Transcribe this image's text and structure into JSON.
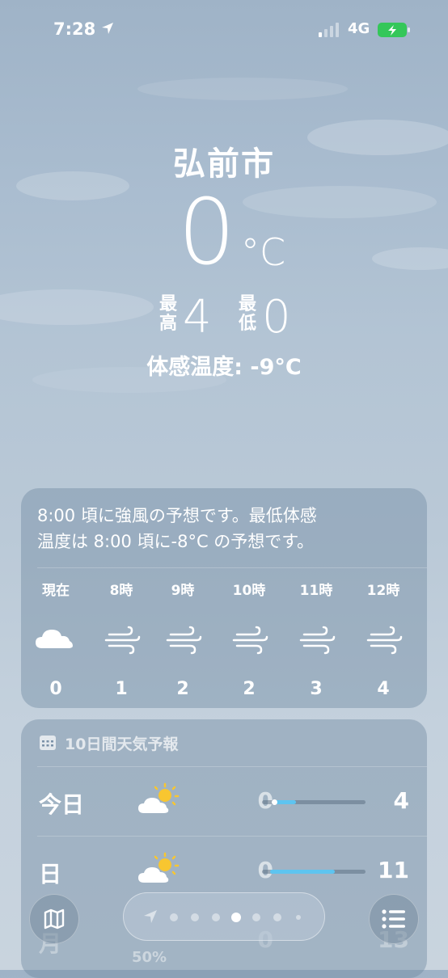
{
  "status_bar": {
    "time": "7:28",
    "network": "4G"
  },
  "header": {
    "city": "弘前市",
    "temperature": "0",
    "unit": "°C",
    "high_label": "最高",
    "high_value": "4",
    "low_label": "最低",
    "low_value": "0",
    "feels_like": "体感温度: -9°C"
  },
  "hourly": {
    "summary_line1": "8:00 頃に強風の予想です。最低体感",
    "summary_line2": "温度は 8:00 頃に-8°C の予想です。",
    "hours": [
      {
        "label": "現在",
        "icon": "cloud-icon",
        "value": "0"
      },
      {
        "label": "8時",
        "icon": "wind-icon",
        "value": "1"
      },
      {
        "label": "9時",
        "icon": "wind-icon",
        "value": "2"
      },
      {
        "label": "10時",
        "icon": "wind-icon",
        "value": "2"
      },
      {
        "label": "11時",
        "icon": "wind-icon",
        "value": "3"
      },
      {
        "label": "12時",
        "icon": "wind-icon",
        "value": "4"
      }
    ]
  },
  "forecast": {
    "title": "10日間天気予報",
    "days": [
      {
        "name": "今日",
        "icon": "partly-sunny-icon",
        "low": "0",
        "high": "4"
      },
      {
        "name": "日",
        "icon": "partly-sunny-icon",
        "low": "0",
        "high": "11"
      },
      {
        "name": "月",
        "icon": "partly-sunny-icon",
        "low": "0",
        "high": "13"
      }
    ]
  },
  "bottom_bar": {
    "precipitation_hint": "50%",
    "page_count": 7,
    "active_page": 4
  },
  "colors": {
    "range_fill": "#5ec4f0",
    "card_bg": "rgba(110,135,160,0.42)"
  }
}
